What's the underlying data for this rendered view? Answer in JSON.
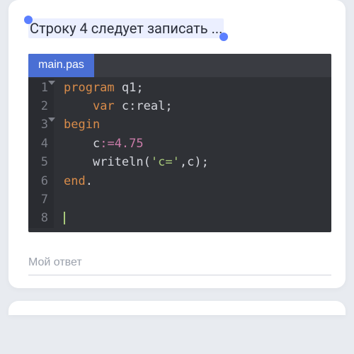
{
  "question": "Строку 4 следует записать ...",
  "editor": {
    "tab": "main.pas",
    "lines": [
      {
        "n": 1,
        "fold": true
      },
      {
        "n": 2,
        "fold": false
      },
      {
        "n": 3,
        "fold": true
      },
      {
        "n": 4,
        "fold": false
      },
      {
        "n": 5,
        "fold": false
      },
      {
        "n": 6,
        "fold": false
      },
      {
        "n": 7,
        "fold": false
      },
      {
        "n": 8,
        "fold": false
      }
    ],
    "code": {
      "l1_kw": "program",
      "l1_id": "q1",
      "l1_semi": ";",
      "l2_kw": "var",
      "l2_id": "c",
      "l2_colon": ":",
      "l2_ty": "real",
      "l2_semi": ";",
      "l3_kw": "begin",
      "l4_id": "c",
      "l4_op": ":=",
      "l4_num": "4.75",
      "l5_fn": "writeln",
      "l5_lp": "(",
      "l5_str": "'c='",
      "l5_comma": ",",
      "l5_arg": "c",
      "l5_rp": ")",
      "l5_semi": ";",
      "l6_kw": "end",
      "l6_dot": "."
    }
  },
  "answer": {
    "placeholder": "Мой ответ",
    "value": ""
  }
}
